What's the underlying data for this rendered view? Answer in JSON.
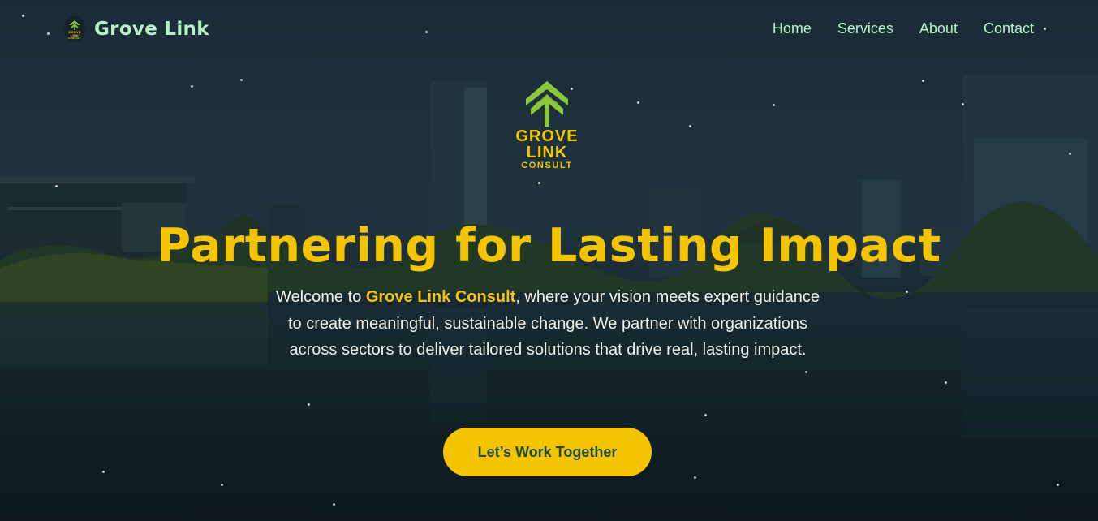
{
  "header": {
    "brand_name": "Grove Link",
    "brand_icon": "grove-link-logo",
    "brand_icon_text": [
      "GROVE",
      "LINK",
      "CONSULT"
    ],
    "nav": [
      {
        "label": "Home"
      },
      {
        "label": "Services"
      },
      {
        "label": "About"
      },
      {
        "label": "Contact"
      }
    ]
  },
  "hero": {
    "logo": {
      "line1": "GROVE",
      "line2": "LINK",
      "line3": "CONSULT"
    },
    "headline": "Partnering for Lasting Impact",
    "lead_before": "Welcome to ",
    "lead_highlight": "Grove Link Consult",
    "lead_after": ", where your vision meets expert guidance to create meaningful, sustainable change. We partner with organizations across sectors to deliver tailored solutions that drive real, lasting impact.",
    "cta_label": "Let’s Work Together"
  },
  "colors": {
    "accent": "#f5c400",
    "brand_text": "#b7f0c4",
    "logo_green": "#8cc63f",
    "cta_text": "#1f4a2a"
  }
}
